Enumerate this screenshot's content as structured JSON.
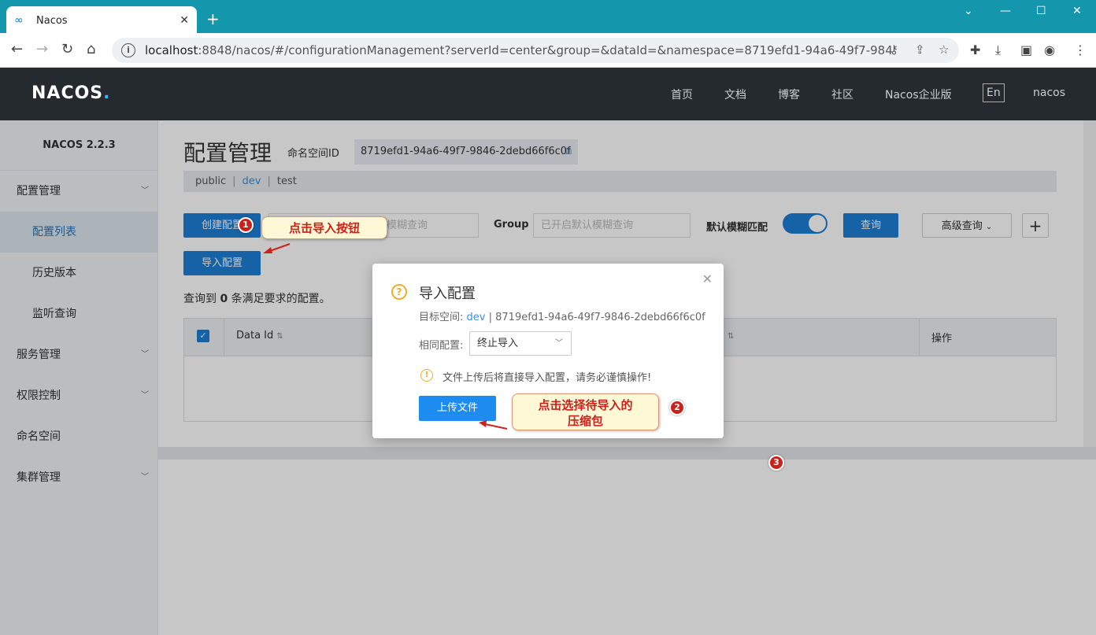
{
  "browser": {
    "tab_title": "Nacos",
    "tab_close": "✕",
    "new_tab": "+",
    "url_host": "localhost",
    "url_rest": ":8848/nacos/#/configurationManagement?serverId=center&group=&dataId=&namespace=8719efd1-94a6-49f7-9846-2debd66f..."
  },
  "header": {
    "logo_main": "NACOS",
    "logo_dot": ".",
    "nav": [
      "首页",
      "文档",
      "博客",
      "社区",
      "Nacos企业版",
      "En",
      "nacos"
    ]
  },
  "sidebar": {
    "version": "NACOS 2.2.3",
    "items": [
      {
        "label": "配置管理"
      },
      {
        "label": "配置列表"
      },
      {
        "label": "历史版本"
      },
      {
        "label": "监听查询"
      },
      {
        "label": "服务管理"
      },
      {
        "label": "权限控制"
      },
      {
        "label": "命名空间"
      },
      {
        "label": "集群管理"
      }
    ]
  },
  "main": {
    "title": "配置管理",
    "ns_label": "命名空间ID",
    "ns_value": "8719efd1-94a6-49f7-9846-2debd66f6c0f",
    "ns_tabs": [
      "public",
      "dev",
      "test"
    ],
    "create_btn": "创建配置",
    "dataid_placeholder": "D",
    "dataid_placeholder_rest": "模糊查询",
    "group_label": "Group",
    "group_placeholder": "已开启默认模糊查询",
    "fuzzy_label": "默认模糊匹配",
    "query_btn": "查询",
    "advanced_btn": "高级查询",
    "plus_btn": "+",
    "import_btn": "导入配置",
    "result_pre": "查询到",
    "result_count": "0",
    "result_post": "条满足要求的配置。",
    "columns": [
      "Data Id",
      "操作"
    ]
  },
  "modal": {
    "title": "导入配置",
    "target_label": "目标空间:",
    "target_ns": "dev",
    "target_rest": "| 8719efd1-94a6-49f7-9846-2debd66f6c0f",
    "same_label": "相同配置:",
    "same_value": "终止导入",
    "warning": "文件上传后将直接导入配置，请务必谨慎操作!",
    "upload_btn": "上传文件"
  },
  "annotations": {
    "callout1": "点击导入按钮",
    "callout2_line1": "点击选择待导入的",
    "callout2_line2": "压缩包",
    "badge1": "1",
    "badge2": "2",
    "badge3": "3"
  }
}
